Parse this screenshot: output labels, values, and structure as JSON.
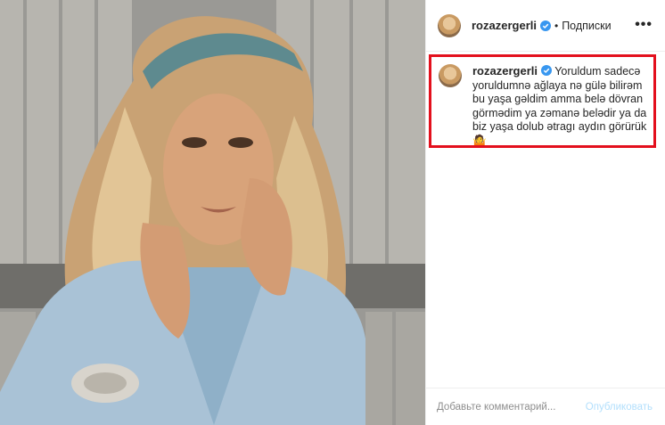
{
  "post": {
    "username": "rozazergerli",
    "follow_label": "Подписки",
    "more_icon": "•••",
    "caption_username": "rozazergerli",
    "caption_text": "Yoruldum sadecə yoruldumnə ağlaya nə gülə bilirəm bu yaşa gəldim amma belə dövran görmədim ya zəmanə belədir ya da biz yaşa dolub ətragı aydın görürük 🤷"
  },
  "comment": {
    "placeholder": "Добавьте комментарий...",
    "publish_label": "Опубликовать"
  },
  "colors": {
    "verified": "#3897f0",
    "highlight_border": "#e3101d",
    "publish_disabled": "#b2dffc"
  }
}
